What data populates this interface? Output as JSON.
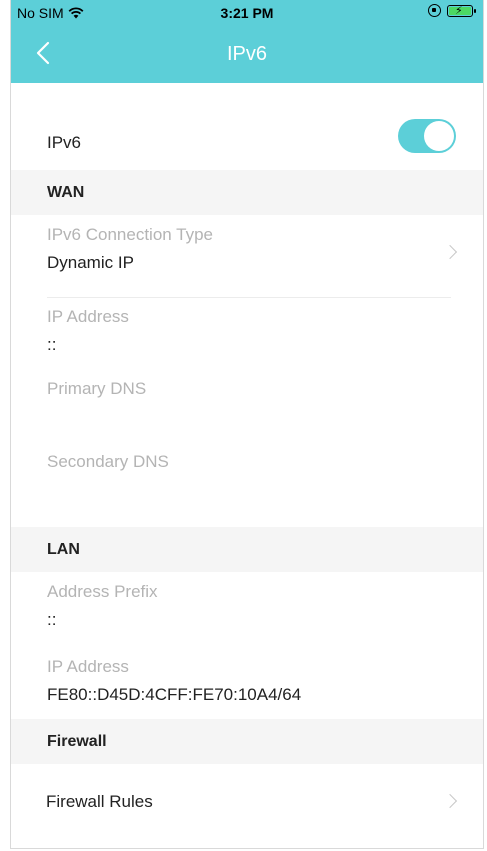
{
  "status_bar": {
    "carrier": "No SIM",
    "time": "3:21 PM"
  },
  "header": {
    "title": "IPv6",
    "background_color": "#5ccfd8"
  },
  "ipv6_toggle": {
    "label": "IPv6",
    "enabled": true,
    "accent_color": "#5ccfd8"
  },
  "wan": {
    "title": "WAN",
    "connection_type_label": "IPv6 Connection Type",
    "connection_type_value": "Dynamic IP",
    "ip_address_label": "IP Address",
    "ip_address_value": "::",
    "primary_dns_label": "Primary DNS",
    "primary_dns_value": "",
    "secondary_dns_label": "Secondary DNS",
    "secondary_dns_value": ""
  },
  "lan": {
    "title": "LAN",
    "address_prefix_label": "Address Prefix",
    "address_prefix_value": "::",
    "ip_address_label": "IP Address",
    "ip_address_value": "FE80::D45D:4CFF:FE70:10A4/64"
  },
  "firewall": {
    "title": "Firewall",
    "rules_label": "Firewall Rules"
  }
}
